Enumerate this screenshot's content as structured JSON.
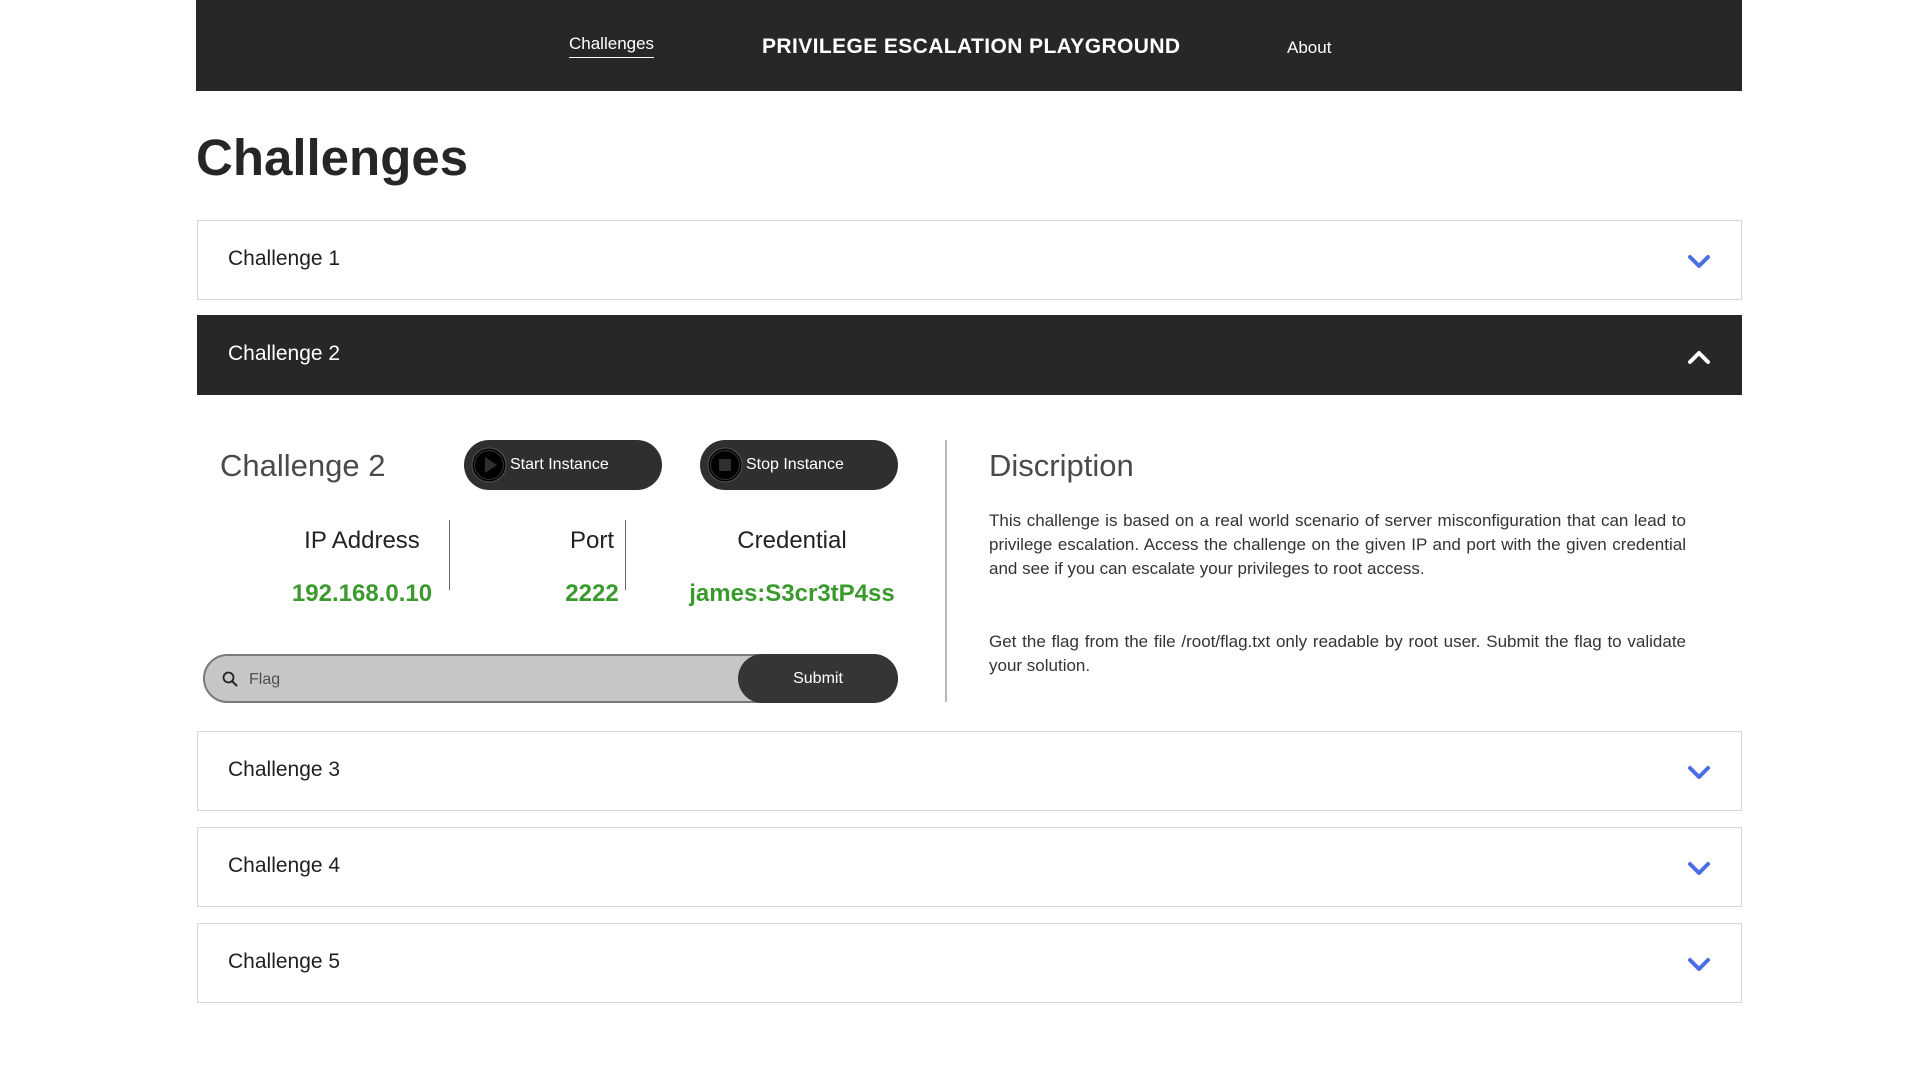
{
  "nav": {
    "challenges_link": "Challenges",
    "brand": "PRIVILEGE ESCALATION PLAYGROUND",
    "about_link": "About"
  },
  "page_title": "Challenges",
  "accordion": [
    {
      "label": "Challenge 1",
      "expanded": false
    },
    {
      "label": "Challenge 2",
      "expanded": true
    },
    {
      "label": "Challenge 3",
      "expanded": false
    },
    {
      "label": "Challenge 4",
      "expanded": false
    },
    {
      "label": "Challenge 5",
      "expanded": false
    }
  ],
  "detail": {
    "heading": "Challenge 2",
    "start_button": "Start Instance",
    "stop_button": "Stop Instance",
    "ip_label": "IP Address",
    "ip_value": "192.168.0.10",
    "port_label": "Port",
    "port_value": "2222",
    "credential_label": "Credential",
    "credential_value": "james:S3cr3tP4ss",
    "flag_placeholder": "Flag",
    "submit_button": "Submit",
    "description_heading": "Discription",
    "description_paragraph_1": "This challenge is based on a real world scenario of server misconfiguration that can lead to privilege escalation. Access the challenge on the given IP and port with the given credential and see if you can escalate your privileges to root access.",
    "description_paragraph_2": "Get the flag from the file /root/flag.txt only readable by root user. Submit the flag to validate your solution."
  },
  "colors": {
    "navbar_bg": "#272727",
    "expanded_header_bg": "#272727",
    "chevron_accent": "#4a6fe3",
    "value_green": "#3a9a2d",
    "flag_field_bg": "#c6c6c6",
    "button_bg": "#2f2f2f"
  },
  "icons": {
    "expand": "chevron-down-icon",
    "collapse": "chevron-up-icon",
    "start": "play-icon",
    "stop": "stop-icon",
    "flag_field": "search-icon"
  }
}
